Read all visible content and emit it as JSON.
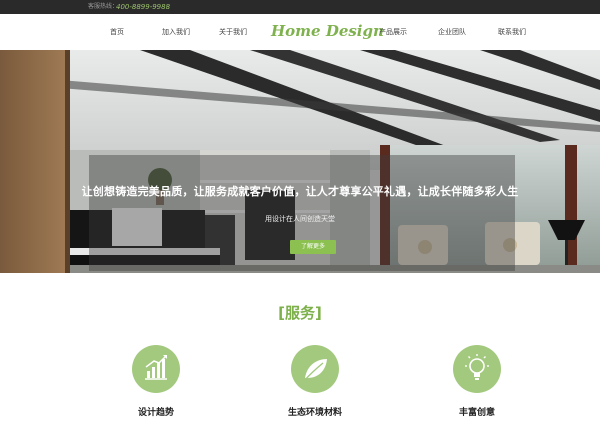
{
  "topbar": {
    "hotline_label": "客服热线：",
    "phone": "400-8899-9988"
  },
  "nav": {
    "logo": "Home Design",
    "items": [
      {
        "label": "首页"
      },
      {
        "label": "加入我们"
      },
      {
        "label": "关于我们"
      },
      {
        "label": "产品展示"
      },
      {
        "label": "企业团队"
      },
      {
        "label": "联系我们"
      }
    ]
  },
  "hero": {
    "headline": "让创想铸造完美品质，让服务成就客户价值，让人才尊享公平礼遇，让成长伴随多彩人生",
    "subline": "用设计在人间创造天堂",
    "more_button": "了解更多"
  },
  "services": {
    "title": "[服务]",
    "cards": [
      {
        "label": "设计趋势",
        "icon": "trend-chart-icon"
      },
      {
        "label": "生态环境材料",
        "icon": "leaf-icon"
      },
      {
        "label": "丰富创意",
        "icon": "lightbulb-icon"
      }
    ]
  },
  "colors": {
    "accent": "#8cc152",
    "topbar": "#2a2a2a",
    "icon_circle": "#a3c97e"
  }
}
